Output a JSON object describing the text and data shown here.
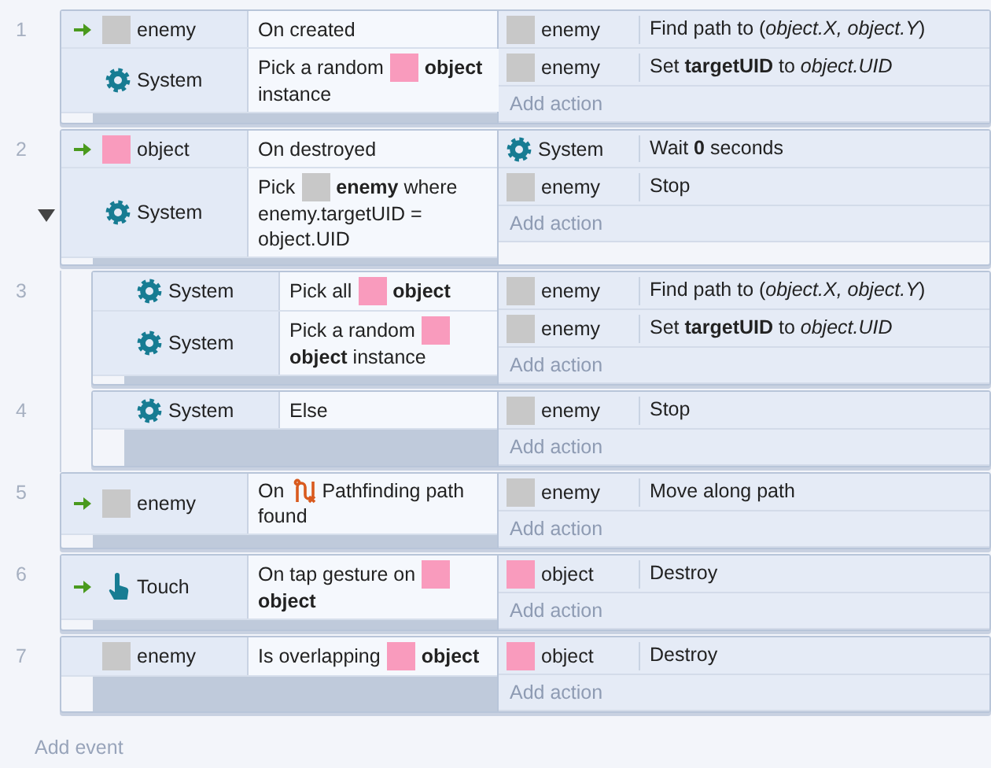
{
  "events": [
    {
      "number": "1",
      "trigger": true,
      "conditions": [
        {
          "object": {
            "kind": "tile",
            "color": "#c8c8c8",
            "name": "enemy"
          },
          "lines": [
            [
              {
                "text": "On created"
              }
            ]
          ]
        },
        {
          "object": {
            "kind": "gear",
            "name": "System"
          },
          "lines": [
            [
              {
                "text": "Pick a random"
              },
              {
                "kind": "tile",
                "color": "#f99bbd"
              },
              {
                "text": "**object**"
              }
            ],
            [
              {
                "text": "instance"
              }
            ]
          ]
        }
      ],
      "actions": [
        {
          "object": {
            "kind": "tile",
            "color": "#c8c8c8",
            "name": "enemy"
          },
          "text": "Find path to (*object.X, object.Y*)"
        },
        {
          "object": {
            "kind": "tile",
            "color": "#c8c8c8",
            "name": "enemy"
          },
          "text": "Set **targetUID** to *object.UID*"
        }
      ],
      "add_action": "Add action"
    },
    {
      "number": "2",
      "trigger": true,
      "expanded": true,
      "conditions": [
        {
          "object": {
            "kind": "tile",
            "color": "#f99bbd",
            "name": "object"
          },
          "lines": [
            [
              {
                "text": "On destroyed"
              }
            ]
          ]
        },
        {
          "object": {
            "kind": "gear",
            "name": "System"
          },
          "lines": [
            [
              {
                "text": "Pick"
              },
              {
                "kind": "tile",
                "color": "#c8c8c8"
              },
              {
                "text": "**enemy** where"
              }
            ],
            [
              {
                "text": "enemy.targetUID ="
              }
            ],
            [
              {
                "text": "object.UID"
              }
            ]
          ]
        }
      ],
      "actions": [
        {
          "object": {
            "kind": "gear",
            "name": "System"
          },
          "text": "Wait **0** seconds"
        },
        {
          "object": {
            "kind": "tile",
            "color": "#c8c8c8",
            "name": "enemy"
          },
          "text": "Stop"
        }
      ],
      "add_action": "Add action",
      "children": [
        {
          "number": "3",
          "trigger": false,
          "conditions": [
            {
              "object": {
                "kind": "gear",
                "name": "System"
              },
              "lines": [
                [
                  {
                    "text": "Pick all"
                  },
                  {
                    "kind": "tile",
                    "color": "#f99bbd"
                  },
                  {
                    "text": "**object**"
                  }
                ]
              ]
            },
            {
              "object": {
                "kind": "gear",
                "name": "System"
              },
              "lines": [
                [
                  {
                    "text": "Pick a random"
                  },
                  {
                    "kind": "tile",
                    "color": "#f99bbd"
                  }
                ],
                [
                  {
                    "text": "**object** instance"
                  }
                ]
              ]
            }
          ],
          "actions": [
            {
              "object": {
                "kind": "tile",
                "color": "#c8c8c8",
                "name": "enemy"
              },
              "text": "Find path to (*object.X, object.Y*)"
            },
            {
              "object": {
                "kind": "tile",
                "color": "#c8c8c8",
                "name": "enemy"
              },
              "text": "Set **targetUID** to *object.UID*"
            }
          ],
          "add_action": "Add action"
        },
        {
          "number": "4",
          "trigger": false,
          "conditions": [
            {
              "object": {
                "kind": "gear",
                "name": "System"
              },
              "lines": [
                [
                  {
                    "text": "Else"
                  }
                ]
              ]
            }
          ],
          "actions": [
            {
              "object": {
                "kind": "tile",
                "color": "#c8c8c8",
                "name": "enemy"
              },
              "text": "Stop"
            }
          ],
          "add_action": "Add action"
        }
      ]
    },
    {
      "number": "5",
      "trigger": true,
      "conditions": [
        {
          "object": {
            "kind": "tile",
            "color": "#c8c8c8",
            "name": "enemy"
          },
          "lines": [
            [
              {
                "text": "On"
              },
              {
                "kind": "pathfinding"
              },
              {
                "text": "Pathfinding path"
              }
            ],
            [
              {
                "text": "found"
              }
            ]
          ]
        }
      ],
      "actions": [
        {
          "object": {
            "kind": "tile",
            "color": "#c8c8c8",
            "name": "enemy"
          },
          "text": "Move along path"
        }
      ],
      "add_action": "Add action"
    },
    {
      "number": "6",
      "trigger": true,
      "conditions": [
        {
          "object": {
            "kind": "touch",
            "name": "Touch"
          },
          "lines": [
            [
              {
                "text": "On tap gesture on"
              },
              {
                "kind": "tile",
                "color": "#f99bbd"
              }
            ],
            [
              {
                "text": "**object**"
              }
            ]
          ]
        }
      ],
      "actions": [
        {
          "object": {
            "kind": "tile",
            "color": "#f99bbd",
            "name": "object"
          },
          "text": "Destroy"
        }
      ],
      "add_action": "Add action"
    },
    {
      "number": "7",
      "trigger": false,
      "conditions": [
        {
          "object": {
            "kind": "tile",
            "color": "#c8c8c8",
            "name": "enemy"
          },
          "lines": [
            [
              {
                "text": "Is overlapping"
              },
              {
                "kind": "tile",
                "color": "#f99bbd"
              },
              {
                "text": "**object**"
              }
            ]
          ]
        }
      ],
      "actions": [
        {
          "object": {
            "kind": "tile",
            "color": "#f99bbd",
            "name": "object"
          },
          "text": "Destroy"
        }
      ],
      "add_action": "Add action"
    }
  ],
  "add_event": "Add event"
}
